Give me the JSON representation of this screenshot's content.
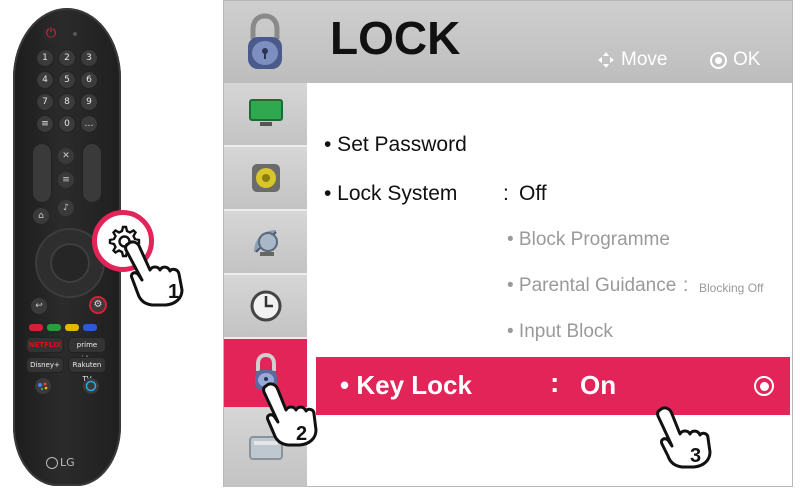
{
  "remote": {
    "brand": "LG",
    "number_keys": [
      "1",
      "2",
      "3",
      "4",
      "5",
      "6",
      "7",
      "8",
      "9",
      "0"
    ],
    "app_keys": [
      "NETFLIX",
      "prime video",
      "Disney+",
      "Rakuten TV"
    ],
    "color_keys": [
      {
        "name": "red",
        "color": "#d81e36"
      },
      {
        "name": "green",
        "color": "#2a9d3a"
      },
      {
        "name": "yellow",
        "color": "#e2b700"
      },
      {
        "name": "blue",
        "color": "#2a5bd7"
      }
    ]
  },
  "steps": {
    "step1": "1",
    "step2": "2",
    "step3": "3"
  },
  "menu": {
    "title": "LOCK",
    "hints": {
      "move_label": "Move",
      "ok_label": "OK"
    },
    "sidebar_icons": [
      "picture-icon",
      "sound-icon",
      "satellite-icon",
      "clock-icon",
      "lock-icon",
      "option-icon"
    ],
    "items": {
      "set_password": "• Set Password",
      "lock_system": "• Lock System",
      "lock_system_colon": ":",
      "lock_system_value": "Off",
      "block_programme": "• Block Programme",
      "parental_guidance": "• Parental Guidance",
      "parental_guidance_colon": ":",
      "parental_guidance_value": "Blocking Off",
      "input_block": "• Input Block"
    },
    "selected": {
      "label": "• Key Lock",
      "colon": ":",
      "value": "On"
    }
  },
  "colors": {
    "accent": "#e32459",
    "header_gray": "#c4c4c4",
    "remote_body": "#262626"
  }
}
